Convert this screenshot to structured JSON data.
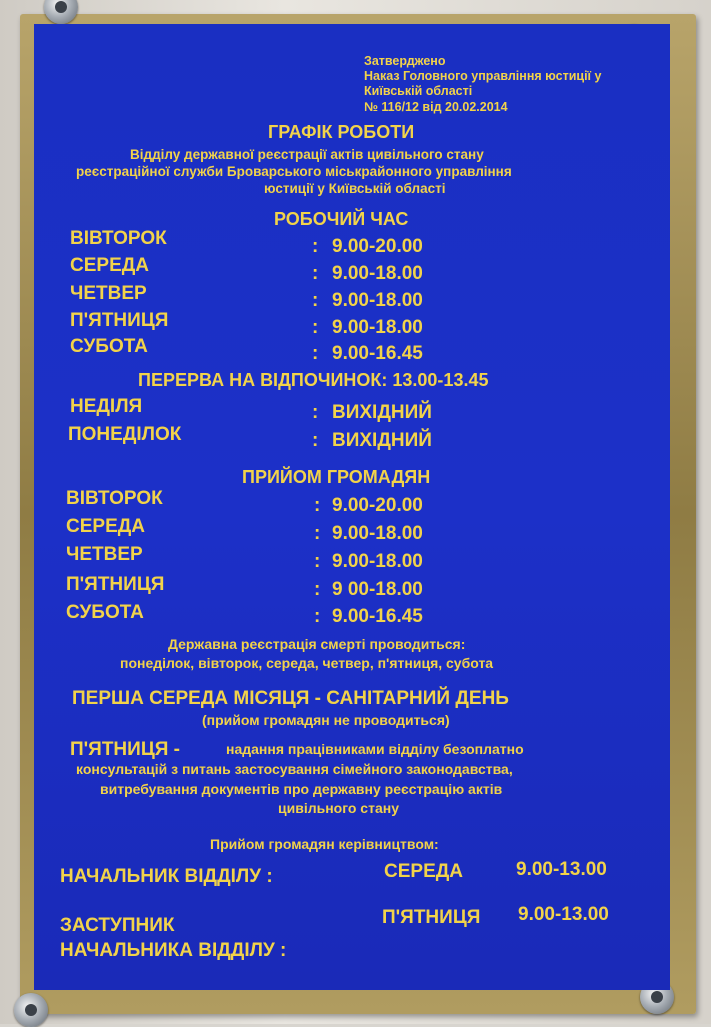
{
  "approval": [
    "Затверджено",
    "Наказ Головного управління юстиції у",
    "Київській області",
    "№ 116/12 від 20.02.2014"
  ],
  "title": "ГРАФІК РОБОТИ",
  "subtitle": [
    "Відділу державної реєстрації актів цивільного стану",
    "реєстраційної служби Броварського міськрайонного управління",
    "юстиції у Київській області"
  ],
  "working_hours": {
    "heading": "РОБОЧИЙ ЧАС",
    "rows": [
      {
        "day": "ВІВТОРОК",
        "time": "9.00-20.00"
      },
      {
        "day": "СЕРЕДА",
        "time": "9.00-18.00"
      },
      {
        "day": "ЧЕТВЕР",
        "time": "9.00-18.00"
      },
      {
        "day": "П'ЯТНИЦЯ",
        "time": "9.00-18.00"
      },
      {
        "day": "СУБОТА",
        "time": "9.00-16.45"
      }
    ],
    "break": "ПЕРЕРВА НА ВІДПОЧИНОК: 13.00-13.45",
    "days_off": [
      {
        "day": "НЕДІЛЯ",
        "time": "ВИХІДНИЙ"
      },
      {
        "day": "ПОНЕДІЛОК",
        "time": "ВИХІДНИЙ"
      }
    ]
  },
  "reception": {
    "heading": "ПРИЙОМ ГРОМАДЯН",
    "rows": [
      {
        "day": "ВІВТОРОК",
        "time": "9.00-20.00"
      },
      {
        "day": "СЕРЕДА",
        "time": "9.00-18.00"
      },
      {
        "day": "ЧЕТВЕР",
        "time": "9.00-18.00"
      },
      {
        "day": "П'ЯТНИЦЯ",
        "time": "9 00-18.00"
      },
      {
        "day": "СУБОТА",
        "time": "9.00-16.45"
      }
    ]
  },
  "death_registration": [
    "Державна реєстрація смерті проводиться:",
    "понеділок, вівторок, середа, четвер, п'ятниця, субота"
  ],
  "sanitary_day": "ПЕРША СЕРЕДА МІСЯЦЯ - САНІТАРНИЙ ДЕНЬ",
  "sanitary_note": "(прийом громадян не проводиться)",
  "friday_label": "П'ЯТНИЦЯ -",
  "friday_text": [
    "надання працівниками відділу безоплатно",
    "консультацій з питань застосування сімейного законодавства,",
    "витребування документів про державну реєстрацію актів",
    "цивільного стану"
  ],
  "management": {
    "heading": "Прийом громадян керівництвом:",
    "head_label": "НАЧАЛЬНИК ВІДДІЛУ :",
    "head_day": "СЕРЕДА",
    "head_time": "9.00-13.00",
    "deputy_label_1": "ЗАСТУПНИК",
    "deputy_label_2": "НАЧАЛЬНИКА ВІДДІЛУ :",
    "deputy_day": "П'ЯТНИЦЯ",
    "deputy_time": "9.00-13.00"
  },
  "colors": {
    "plate": "#1c30c8",
    "text": "#f2d34a",
    "frame": "#a8935a"
  }
}
